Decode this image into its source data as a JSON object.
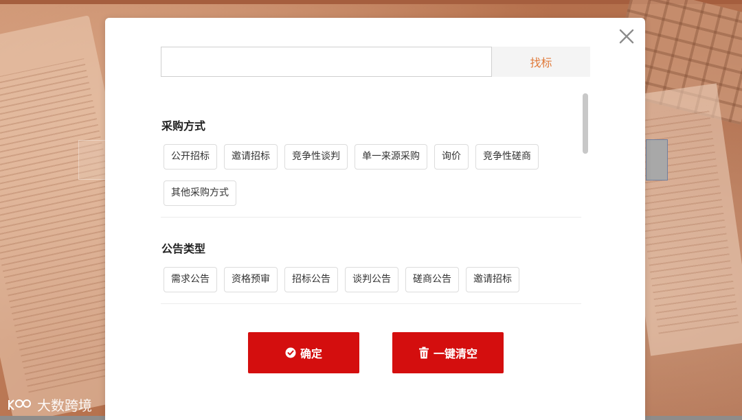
{
  "search": {
    "value": "",
    "placeholder": "",
    "button_label": "找标"
  },
  "sections": [
    {
      "title": "采购方式",
      "tags": [
        "公开招标",
        "邀请招标",
        "竞争性谈判",
        "单一来源采购",
        "询价",
        "竞争性磋商",
        "其他采购方式"
      ]
    },
    {
      "title": "公告类型",
      "tags": [
        "需求公告",
        "资格预审",
        "招标公告",
        "谈判公告",
        "磋商公告",
        "邀请招标"
      ]
    }
  ],
  "actions": {
    "confirm_label": "确定",
    "clear_label": "一键清空"
  },
  "watermark": {
    "text": "大数跨境"
  },
  "colors": {
    "accent_red": "#d40e0e",
    "search_button_text": "#e07a3a"
  }
}
